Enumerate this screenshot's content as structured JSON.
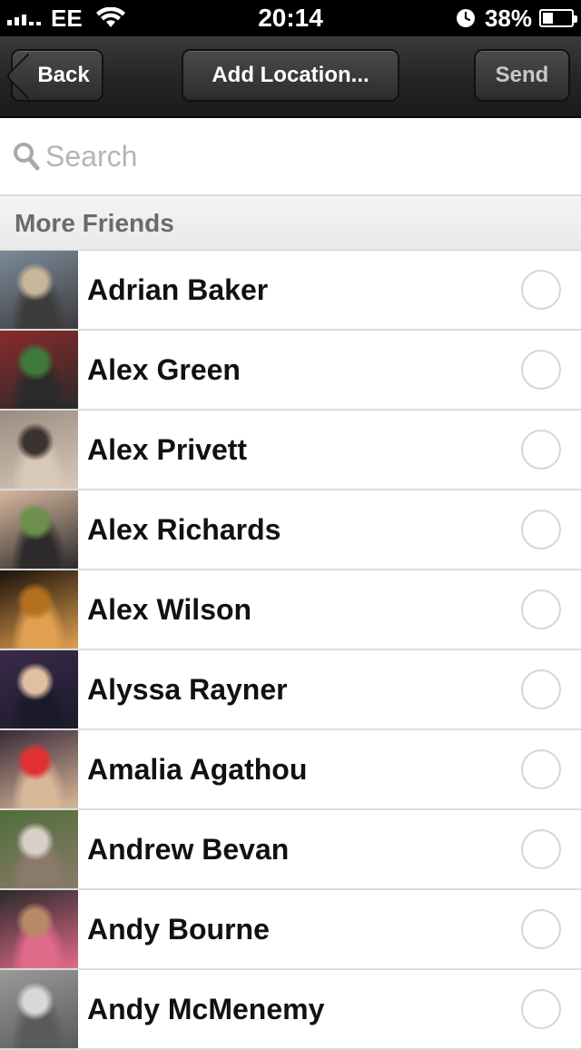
{
  "status_bar": {
    "carrier": "EE",
    "time": "20:14",
    "battery_percent": "38%",
    "battery_level": 0.38,
    "signal_icon": "signal-bars-icon",
    "wifi_icon": "wifi-icon",
    "alarm_icon": "alarm-clock-icon",
    "battery_icon": "battery-icon"
  },
  "nav": {
    "back_label": "Back",
    "title_button_label": "Add Location...",
    "send_label": "Send"
  },
  "search": {
    "placeholder": "Search",
    "value": "",
    "icon": "search-icon"
  },
  "section": {
    "title": "More Friends"
  },
  "friends": [
    {
      "name": "Adrian Baker",
      "selected": false,
      "photo_colors": [
        "#7d8a9a",
        "#c7b79a",
        "#3c3c3c"
      ]
    },
    {
      "name": "Alex Green",
      "selected": false,
      "photo_colors": [
        "#8a2a2a",
        "#3f7a3c",
        "#2a2a2a"
      ]
    },
    {
      "name": "Alex Privett",
      "selected": false,
      "photo_colors": [
        "#9a8c80",
        "#3a3330",
        "#d8c8b8"
      ]
    },
    {
      "name": "Alex Richards",
      "selected": false,
      "photo_colors": [
        "#d6b8a0",
        "#6d8f4c",
        "#2c2a2a"
      ]
    },
    {
      "name": "Alex Wilson",
      "selected": false,
      "photo_colors": [
        "#1a120a",
        "#b5701f",
        "#e0a050"
      ]
    },
    {
      "name": "Alyssa Rayner",
      "selected": false,
      "photo_colors": [
        "#3a2a4a",
        "#e0c0a0",
        "#1a1a2a"
      ]
    },
    {
      "name": "Amalia Agathou",
      "selected": false,
      "photo_colors": [
        "#3a2a3a",
        "#e03030",
        "#d8b898"
      ]
    },
    {
      "name": "Andrew Bevan",
      "selected": false,
      "photo_colors": [
        "#4f6e3a",
        "#d8d0c8",
        "#8a7a6a"
      ]
    },
    {
      "name": "Andy Bourne",
      "selected": false,
      "photo_colors": [
        "#2a2a2a",
        "#b88a6a",
        "#e06a8a"
      ]
    },
    {
      "name": "Andy McMenemy",
      "selected": false,
      "photo_colors": [
        "#9a9a9a",
        "#d8d8d8",
        "#5a5a5a"
      ]
    }
  ]
}
